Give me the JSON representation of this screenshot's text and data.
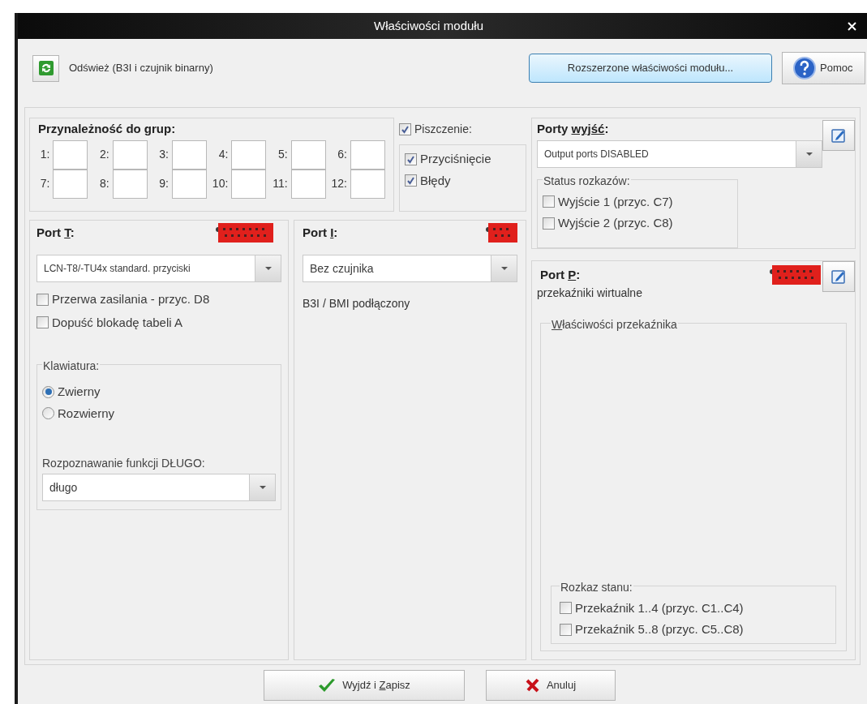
{
  "window": {
    "title": "Właściwości modułu"
  },
  "toolbar": {
    "refresh_label": "Odśwież (B3I i czujnik binarny)",
    "extended_button": "Rozszerzone właściwości modułu...",
    "help_button": "Pomoc"
  },
  "groups": {
    "title": "Przynależność do grup:",
    "fields": [
      {
        "label": "1:"
      },
      {
        "label": "2:"
      },
      {
        "label": "3:"
      },
      {
        "label": "4:"
      },
      {
        "label": "5:"
      },
      {
        "label": "6:"
      },
      {
        "label": "7:"
      },
      {
        "label": "8:"
      },
      {
        "label": "9:"
      },
      {
        "label": "10:"
      },
      {
        "label": "11:"
      },
      {
        "label": "12:"
      }
    ]
  },
  "beep": {
    "label": "Piszczenie:",
    "checked": true,
    "options": [
      {
        "label": "Przyciśnięcie",
        "checked": true
      },
      {
        "label": "Błędy",
        "checked": true
      }
    ]
  },
  "output_ports": {
    "title": [
      "Porty ",
      "wyjść",
      ":"
    ],
    "select": "Output ports DISABLED",
    "status_title": "Status rozkazów:",
    "options": [
      {
        "label": "Wyjście 1 (przyc. C7)",
        "checked": false
      },
      {
        "label": "Wyjście 2 (przyc. C8)",
        "checked": false
      }
    ]
  },
  "port_t": {
    "title": [
      "Port ",
      "T",
      ":"
    ],
    "select": "LCN-T8/-TU4x standard. przyciski",
    "options": [
      {
        "label": "Przerwa zasilania - przyc. D8",
        "checked": false
      },
      {
        "label": "Dopuść blokadę tabeli A",
        "checked": false
      }
    ],
    "keyboard": {
      "title": "Klawiatura:",
      "options": [
        {
          "label": "Zwierny",
          "selected": true
        },
        {
          "label": "Rozwierny",
          "selected": false
        }
      ]
    },
    "long_label": "Rozpoznawanie funkcji DŁUGO:",
    "long_select": "długo"
  },
  "port_i": {
    "title": [
      "Port ",
      "I",
      ":"
    ],
    "select": "Bez czujnika",
    "status": "B3I / BMI podłączony"
  },
  "port_p": {
    "title": [
      "Port ",
      "P",
      ":"
    ],
    "subtitle": "przekaźniki wirtualne",
    "relay_title": {
      "underlined": "W",
      "rest": "łaściwości przekaźnika"
    },
    "state_title": "Rozkaz stanu:",
    "options": [
      {
        "label": "Przekaźnik 1..4 (przyc. C1..C4)",
        "checked": false
      },
      {
        "label": "Przekaźnik 5..8 (przyc. C5..C8)",
        "checked": false
      }
    ]
  },
  "buttons": [
    {
      "kind": "save",
      "label": [
        "Wyjdź i ",
        "Z",
        "apisz"
      ]
    },
    {
      "kind": "cancel",
      "label": [
        "Anuluj"
      ]
    }
  ]
}
